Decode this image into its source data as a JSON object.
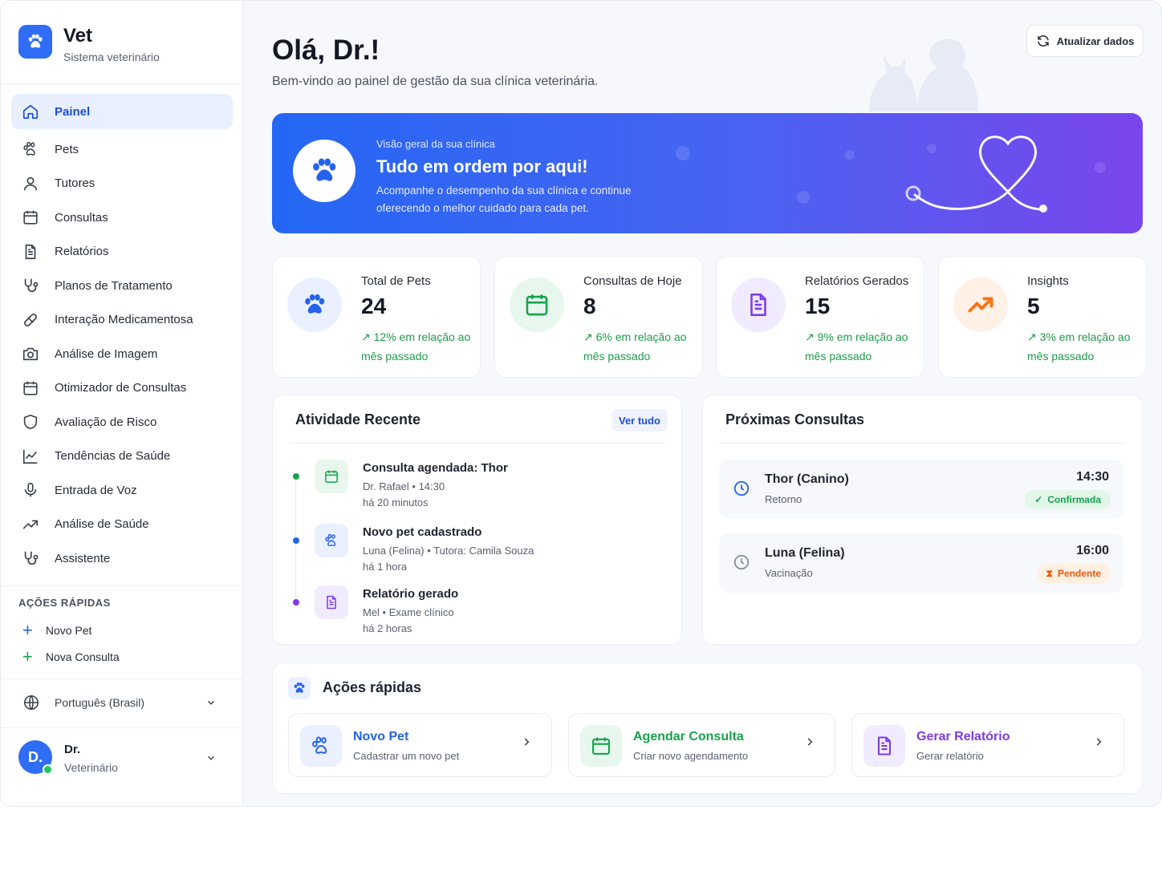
{
  "brand": {
    "name": "Vet",
    "subtitle": "Sistema veterinário",
    "icon": "paw-icon"
  },
  "nav": [
    {
      "label": "Painel",
      "icon": "home-icon",
      "active": true
    },
    {
      "label": "Pets",
      "icon": "paw-icon"
    },
    {
      "label": "Tutores",
      "icon": "user-icon"
    },
    {
      "label": "Consultas",
      "icon": "calendar-icon"
    },
    {
      "label": "Relatórios",
      "icon": "document-icon"
    },
    {
      "label": "Planos de Tratamento",
      "icon": "stethoscope-icon"
    },
    {
      "label": "Interação Medicamentosa",
      "icon": "pill-icon"
    },
    {
      "label": "Análise de Imagem",
      "icon": "camera-icon"
    },
    {
      "label": "Otimizador de Consultas",
      "icon": "calendar-icon"
    },
    {
      "label": "Avaliação de Risco",
      "icon": "shield-icon"
    },
    {
      "label": "Tendências de Saúde",
      "icon": "line-chart-icon"
    },
    {
      "label": "Entrada de Voz",
      "icon": "microphone-icon"
    },
    {
      "label": "Análise de Saúde",
      "icon": "trending-up-icon"
    },
    {
      "label": "Assistente",
      "icon": "stethoscope-icon"
    }
  ],
  "sidebar_quick": {
    "title": "AÇÕES RÁPIDAS",
    "items": [
      {
        "label": "Novo Pet",
        "color": "#2563eb"
      },
      {
        "label": "Nova Consulta",
        "color": "#16a34a"
      }
    ]
  },
  "language": {
    "label": "Português (Brasil)",
    "icon": "globe-icon"
  },
  "user": {
    "initials": "D.",
    "name": "Dr.",
    "role": "Veterinário",
    "status": "online"
  },
  "header": {
    "greeting": "Olá, Dr.!",
    "welcome": "Bem-vindo ao painel de gestão da sua clínica veterinária.",
    "refresh_label": "Atualizar dados"
  },
  "hero": {
    "eyebrow": "Visão geral da sua clínica",
    "title": "Tudo em ordem por aqui!",
    "text": "Acompanhe o desempenho da sua clínica e continue oferecendo o melhor cuidado para cada pet."
  },
  "stats": [
    {
      "label": "Total de Pets",
      "value": "24",
      "trend": "12% em relação ao mês passado",
      "icon": "paw-icon",
      "color": "#2563eb",
      "bg": "#eaf0ff"
    },
    {
      "label": "Consultas de Hoje",
      "value": "8",
      "trend": "6% em relação ao mês passado",
      "icon": "calendar-icon",
      "color": "#16a34a",
      "bg": "#e8f7ee"
    },
    {
      "label": "Relatórios Gerados",
      "value": "15",
      "trend": "9% em relação ao mês passado",
      "icon": "document-icon",
      "color": "#7c3aed",
      "bg": "#f1ebff"
    },
    {
      "label": "Insights",
      "value": "5",
      "trend": "3% em relação ao mês passado",
      "icon": "trending-up-icon",
      "color": "#f97316",
      "bg": "#fff1e6"
    }
  ],
  "activity": {
    "title": "Atividade Recente",
    "see_all": "Ver tudo",
    "items": [
      {
        "title": "Consulta agendada: Thor",
        "meta": "Dr. Rafael  •  14:30",
        "when": "há 20 minutos",
        "icon": "calendar-icon",
        "color": "#16a34a",
        "bg": "#e8f7ee"
      },
      {
        "title": "Novo pet cadastrado",
        "meta": "Luna (Felina)  •  Tutora: Camila Souza",
        "when": "há 1 hora",
        "icon": "paw-icon",
        "color": "#2563eb",
        "bg": "#eaf0ff"
      },
      {
        "title": "Relatório gerado",
        "meta": "Mel  •  Exame clínico",
        "when": "há 2 horas",
        "icon": "document-icon",
        "color": "#7c3aed",
        "bg": "#f1ebff"
      }
    ]
  },
  "upcoming": {
    "title": "Próximas Consultas",
    "items": [
      {
        "name": "Thor (Canino)",
        "kind": "Retorno",
        "time": "14:30",
        "status": "Confirmada",
        "status_color": "#16a34a",
        "status_bg": "#e3f6ea",
        "icon": "clock-icon",
        "icon_color": "#2563eb"
      },
      {
        "name": "Luna (Felina)",
        "kind": "Vacinação",
        "time": "16:00",
        "status": "Pendente",
        "status_color": "#ea580c",
        "status_bg": "#fff0e1",
        "icon": "clock-icon",
        "icon_color": "#8a90a0"
      }
    ]
  },
  "quick_actions": {
    "title": "Ações rápidas",
    "items": [
      {
        "title": "Novo Pet",
        "subtitle": "Cadastrar um novo pet",
        "icon": "paw-icon",
        "color": "#2563eb",
        "bg": "#eaf0ff"
      },
      {
        "title": "Agendar Consulta",
        "subtitle": "Criar novo agendamento",
        "icon": "calendar-icon",
        "color": "#16a34a",
        "bg": "#e8f7ee"
      },
      {
        "title": "Gerar Relatório",
        "subtitle": "Gerar relatório",
        "icon": "document-icon",
        "color": "#7c3aed",
        "bg": "#f1ebff"
      }
    ]
  }
}
